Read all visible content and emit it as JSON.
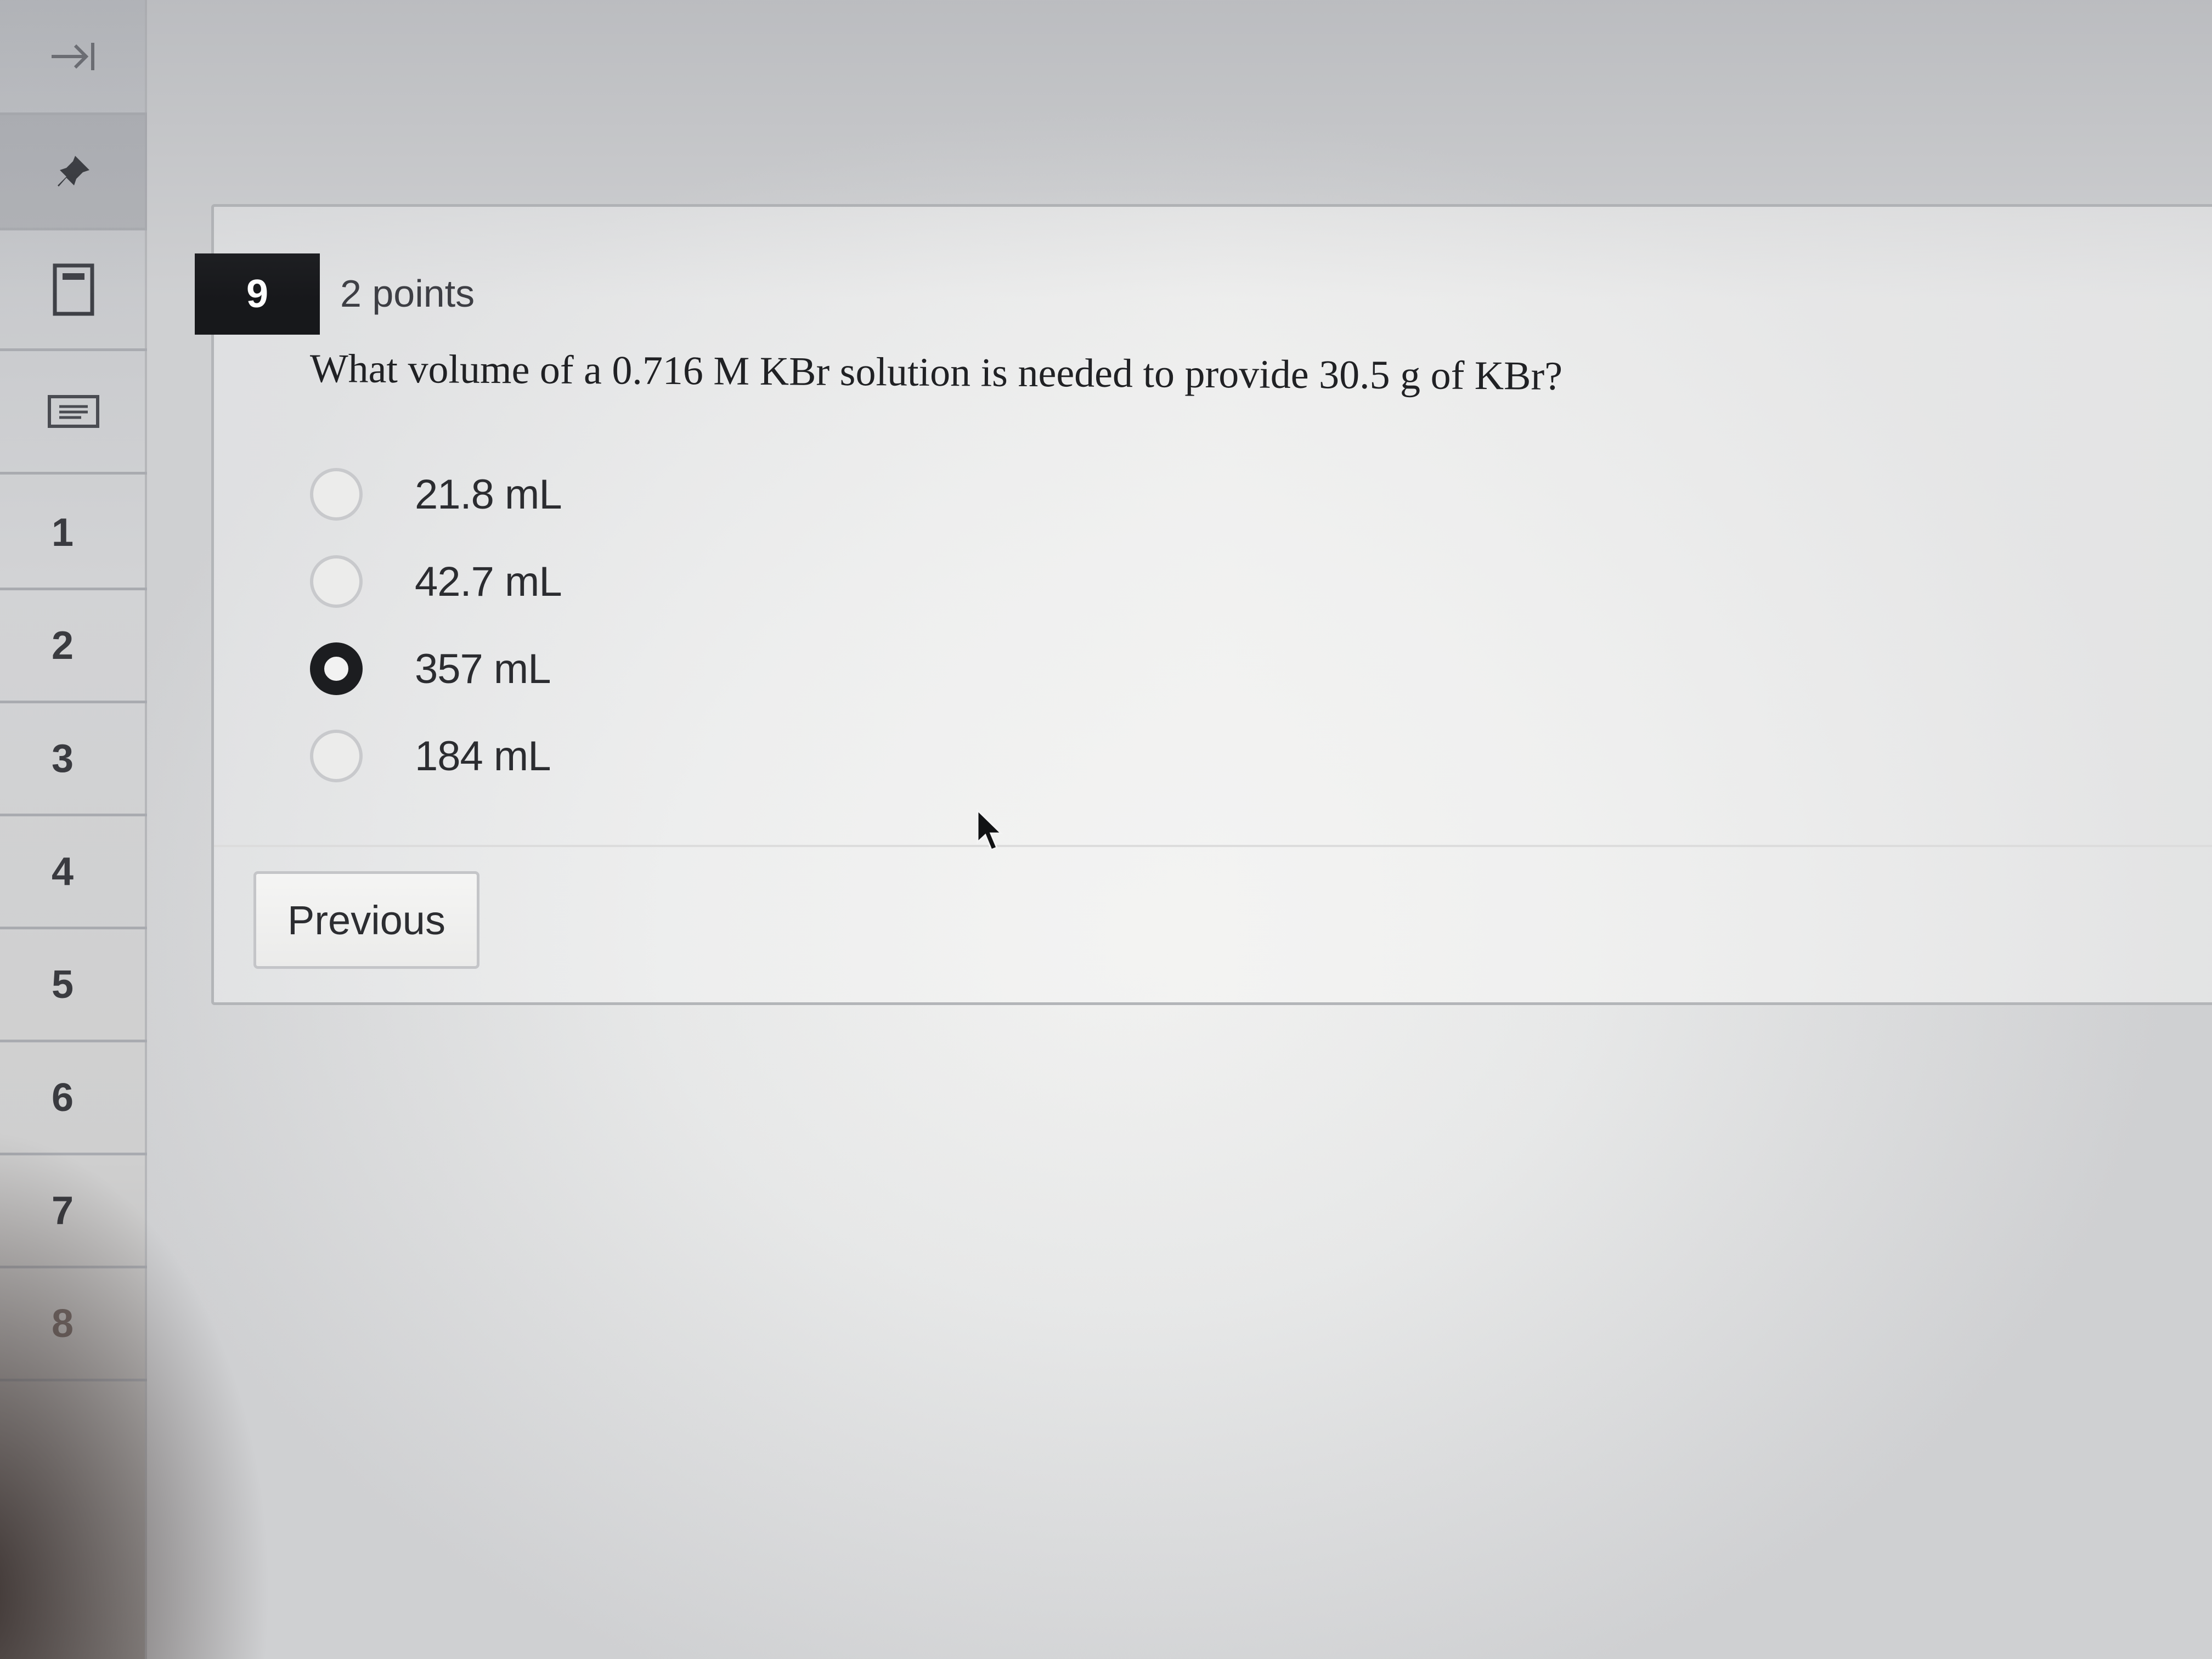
{
  "sidebar": {
    "nav_items": [
      "1",
      "2",
      "3",
      "4",
      "5",
      "6",
      "7",
      "8"
    ]
  },
  "question": {
    "number": "9",
    "points": "2 points",
    "text": "What volume of a 0.716 M KBr solution is needed to provide 30.5 g of KBr?",
    "options": [
      {
        "label": "21.8 mL",
        "selected": false
      },
      {
        "label": "42.7 mL",
        "selected": false
      },
      {
        "label": "357 mL",
        "selected": true
      },
      {
        "label": "184 mL",
        "selected": false
      }
    ]
  },
  "navigation": {
    "previous_label": "Previous"
  },
  "colors": {
    "question_badge_bg": "#17181b",
    "selected_radio": "#1c1d20"
  }
}
